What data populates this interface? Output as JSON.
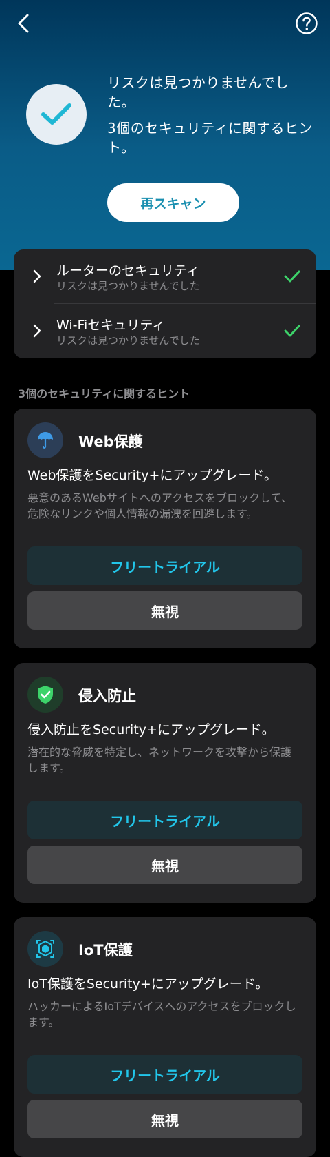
{
  "header": {
    "back_icon": "chevron-left-icon",
    "help_icon": "question-circle-icon"
  },
  "status": {
    "icon": "checkmark-icon",
    "line1": "リスクは見つかりませんでした。",
    "line2": "3個のセキュリティに関するヒント。"
  },
  "rescan_label": "再スキャン",
  "scan_results": [
    {
      "title": "ルーターのセキュリティ",
      "subtitle": "リスクは見つかりませんでした",
      "status_color": "#3dd36a"
    },
    {
      "title": "Wi-Fiセキュリティ",
      "subtitle": "リスクは見つかりませんでした",
      "status_color": "#3dd36a"
    }
  ],
  "tips_section_label": "3個のセキュリティに関するヒント",
  "tips": [
    {
      "name": "Web保護",
      "icon": "umbrella-icon",
      "headline": "Web保護をSecurity+にアップグレード。",
      "description": "悪意のあるWebサイトへのアクセスをブロックして、危険なリンクや個人情報の漏洩を回避します。",
      "trial_label": "フリートライアル",
      "ignore_label": "無視"
    },
    {
      "name": "侵入防止",
      "icon": "shield-check-icon",
      "headline": "侵入防止をSecurity+にアップグレード。",
      "description": "潜在的な脅威を特定し、ネットワークを攻撃から保護します。",
      "trial_label": "フリートライアル",
      "ignore_label": "無視"
    },
    {
      "name": "IoT保護",
      "icon": "iot-cube-icon",
      "headline": "IoT保護をSecurity+にアップグレード。",
      "description": "ハッカーによるIoTデバイスへのアクセスをブロックします。",
      "trial_label": "フリートライアル",
      "ignore_label": "無視"
    }
  ],
  "colors": {
    "accent": "#22c6ea",
    "success": "#3dd36a",
    "card_bg": "#232325",
    "hero_top": "#00365a",
    "hero_bottom": "#0a6792"
  }
}
